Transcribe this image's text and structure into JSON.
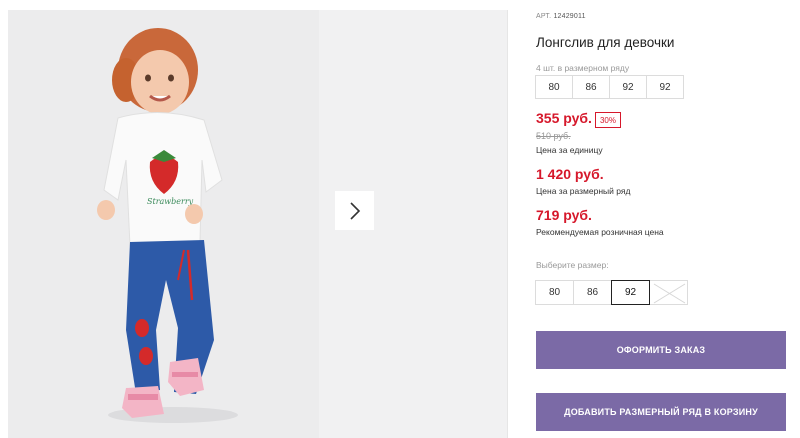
{
  "product": {
    "sku_prefix": "АРТ.",
    "sku": "12429011",
    "title": "Лонгслив для девочки"
  },
  "pack": {
    "label": "4 шт. в размерном ряду",
    "sizes": [
      "80",
      "86",
      "92",
      "92"
    ]
  },
  "prices": {
    "unit_price": "355 руб.",
    "discount": "30%",
    "old_price": "510 руб.",
    "unit_label": "Цена за единицу",
    "pack_price": "1 420 руб.",
    "pack_label": "Цена за размерный ряд",
    "retail_price": "719 руб.",
    "retail_label": "Рекомендуемая розничная цена"
  },
  "size_select": {
    "label": "Выберите размер:",
    "options": [
      "80",
      "86",
      "92",
      ""
    ],
    "selected": "92"
  },
  "actions": {
    "order_label": "ОФОРМИТЬ ЗАКАЗ",
    "cart_label": "ДОБАВИТЬ РАЗМЕРНЫЙ РЯД В КОРЗИНУ"
  },
  "icons": {
    "next": "chevron-right-icon",
    "unavailable": "cross-out-icon"
  },
  "colors": {
    "accent": "#7b6aa6",
    "price": "#d6182b"
  }
}
